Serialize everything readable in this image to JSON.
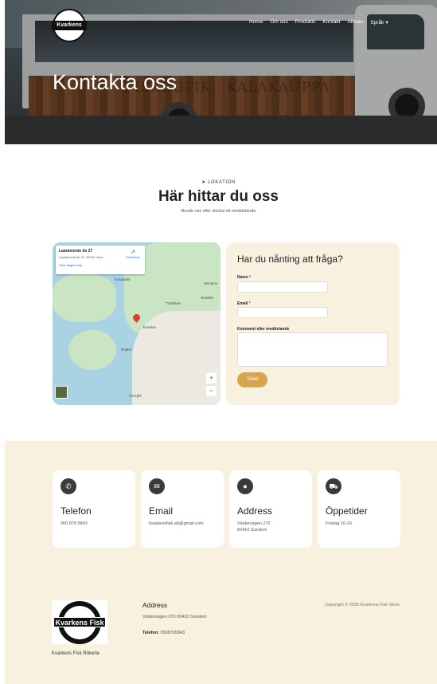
{
  "header": {
    "logo_text": "Kvarkens Fisk",
    "nav": [
      "Home",
      "Om oss",
      "Produkts",
      "Kontakt",
      "Allman",
      "Språk"
    ],
    "hero_title": "Kontakta oss",
    "hero_faded_text": "FISKBUTIK - KALAKAUPPA"
  },
  "location": {
    "label": "LOKATION",
    "title": "Här hittar du oss",
    "subtitle": "Besök oss eller skicka ett meddelande"
  },
  "map": {
    "card_title": "Laaramonie tie 27",
    "card_address": "Laaramonie tie 27, 65410 Vasa",
    "card_link": "View larger map",
    "directions": "Directions",
    "labels": [
      "Koivulahti",
      "Munsmo",
      "Helsinki",
      "Kvevlax",
      "Replot",
      "Tvärälven"
    ],
    "zoom_in": "+",
    "zoom_out": "−",
    "google": "Google"
  },
  "form": {
    "title": "Har du nånting att fråga?",
    "name_label": "Namn",
    "email_label": "Email",
    "message_label": "Komment eller meddelande",
    "required_mark": "*",
    "submit_label": "Sänd"
  },
  "info_cards": [
    {
      "icon": "phone-icon",
      "glyph": "✆",
      "title": "Telefon",
      "value": "050 876 5843"
    },
    {
      "icon": "envelope-icon",
      "glyph": "✉",
      "title": "Email",
      "value": "kvarkensfisk.ab@gmail.com"
    },
    {
      "icon": "location-pin-icon",
      "glyph": "●",
      "title": "Address",
      "value": "Västervägen 270\n65410 Sundom"
    },
    {
      "icon": "truck-icon",
      "glyph": "⛟",
      "title": "Öppetider",
      "value": "Fredag 10-16"
    }
  ],
  "footer": {
    "logo_text": "Kvarkens Fisk",
    "tagline": "Kvarkens Fisk Rökerie",
    "address_heading": "Address",
    "address": "Västervägen 270 65410 Sundom",
    "phone_label": "Telefon:",
    "phone": "0508765843",
    "copyright": "Copyright © 2025 Kvarkens Fisk Store"
  },
  "colors": {
    "accent": "#d8a54a",
    "cream": "#f8f1df",
    "dark_icon": "#3a3a3a"
  }
}
